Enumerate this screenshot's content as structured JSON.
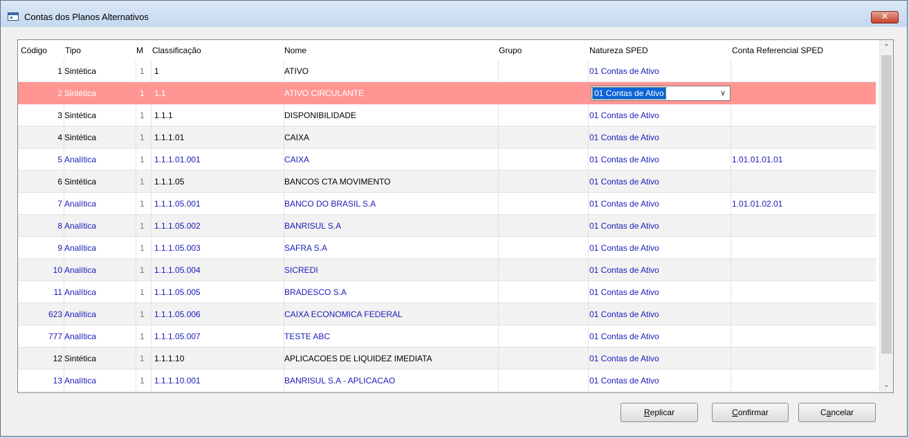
{
  "window": {
    "title": "Contas dos Planos Alternativos",
    "close_label": "✕"
  },
  "grid": {
    "columns": [
      "Código",
      "Tipo",
      "M",
      "Classificação",
      "Nome",
      "Grupo",
      "Natureza SPED",
      "Conta Referencial SPED"
    ],
    "rows": [
      {
        "codigo": "1",
        "tipo": "Sintética",
        "m": "1",
        "classificacao": "1",
        "nome": "ATIVO",
        "grupo": "",
        "natureza": "01 Contas de Ativo",
        "conta_ref": ""
      },
      {
        "codigo": "2",
        "tipo": "Sintética",
        "m": "1",
        "classificacao": "1.1",
        "nome": "ATIVO CIRCULANTE",
        "grupo": "",
        "natureza": "01 Contas de Ativo",
        "conta_ref": "",
        "selected": true
      },
      {
        "codigo": "3",
        "tipo": "Sintética",
        "m": "1",
        "classificacao": "1.1.1",
        "nome": "DISPONIBILIDADE",
        "grupo": "",
        "natureza": "01 Contas de Ativo",
        "conta_ref": ""
      },
      {
        "codigo": "4",
        "tipo": "Sintética",
        "m": "1",
        "classificacao": "1.1.1.01",
        "nome": "CAIXA",
        "grupo": "",
        "natureza": "01 Contas de Ativo",
        "conta_ref": ""
      },
      {
        "codigo": "5",
        "tipo": "Analítica",
        "m": "1",
        "classificacao": "1.1.1.01.001",
        "nome": "CAIXA",
        "grupo": "",
        "natureza": "01 Contas de Ativo",
        "conta_ref": "1.01.01.01.01"
      },
      {
        "codigo": "6",
        "tipo": "Sintética",
        "m": "1",
        "classificacao": "1.1.1.05",
        "nome": "BANCOS CTA MOVIMENTO",
        "grupo": "",
        "natureza": "01 Contas de Ativo",
        "conta_ref": ""
      },
      {
        "codigo": "7",
        "tipo": "Analítica",
        "m": "1",
        "classificacao": "1.1.1.05.001",
        "nome": "BANCO DO BRASIL S.A",
        "grupo": "",
        "natureza": "01 Contas de Ativo",
        "conta_ref": "1.01.01.02.01"
      },
      {
        "codigo": "8",
        "tipo": "Analítica",
        "m": "1",
        "classificacao": "1.1.1.05.002",
        "nome": "BANRISUL S.A",
        "grupo": "",
        "natureza": "01 Contas de Ativo",
        "conta_ref": ""
      },
      {
        "codigo": "9",
        "tipo": "Analítica",
        "m": "1",
        "classificacao": "1.1.1.05.003",
        "nome": "SAFRA S.A",
        "grupo": "",
        "natureza": "01 Contas de Ativo",
        "conta_ref": ""
      },
      {
        "codigo": "10",
        "tipo": "Analítica",
        "m": "1",
        "classificacao": "1.1.1.05.004",
        "nome": "SICREDI",
        "grupo": "",
        "natureza": "01 Contas de Ativo",
        "conta_ref": ""
      },
      {
        "codigo": "11",
        "tipo": "Analítica",
        "m": "1",
        "classificacao": "1.1.1.05.005",
        "nome": "BRADESCO S.A",
        "grupo": "",
        "natureza": "01 Contas de Ativo",
        "conta_ref": ""
      },
      {
        "codigo": "623",
        "tipo": "Analítica",
        "m": "1",
        "classificacao": "1.1.1.05.006",
        "nome": "CAIXA ECONOMICA FEDERAL",
        "grupo": "",
        "natureza": "01 Contas de Ativo",
        "conta_ref": ""
      },
      {
        "codigo": "777",
        "tipo": "Analítica",
        "m": "1",
        "classificacao": "1.1.1.05.007",
        "nome": "TESTE ABC",
        "grupo": "",
        "natureza": "01 Contas de Ativo",
        "conta_ref": ""
      },
      {
        "codigo": "12",
        "tipo": "Sintética",
        "m": "1",
        "classificacao": "1.1.1.10",
        "nome": "APLICACOES DE LIQUIDEZ IMEDIATA",
        "grupo": "",
        "natureza": "01 Contas de Ativo",
        "conta_ref": ""
      },
      {
        "codigo": "13",
        "tipo": "Analítica",
        "m": "1",
        "classificacao": "1.1.1.10.001",
        "nome": "BANRISUL S.A - APLICACAO",
        "grupo": "",
        "natureza": "01 Contas de Ativo",
        "conta_ref": ""
      }
    ],
    "combo_value": "01 Contas de Ativo"
  },
  "buttons": {
    "replicar": {
      "first": "R",
      "rest": "eplicar"
    },
    "confirmar": {
      "first": "C",
      "rest": "onfirmar"
    },
    "cancelar": {
      "pre": "C",
      "u": "a",
      "post": "ncelar"
    }
  },
  "colors": {
    "selected_row": "#ff9693",
    "analitica_text": "#1a1ab8",
    "combo_highlight": "#0a64d8"
  },
  "icons": [
    "app-window-icon",
    "close-icon",
    "chevron-down-icon",
    "scroll-up-icon",
    "scroll-down-icon"
  ]
}
